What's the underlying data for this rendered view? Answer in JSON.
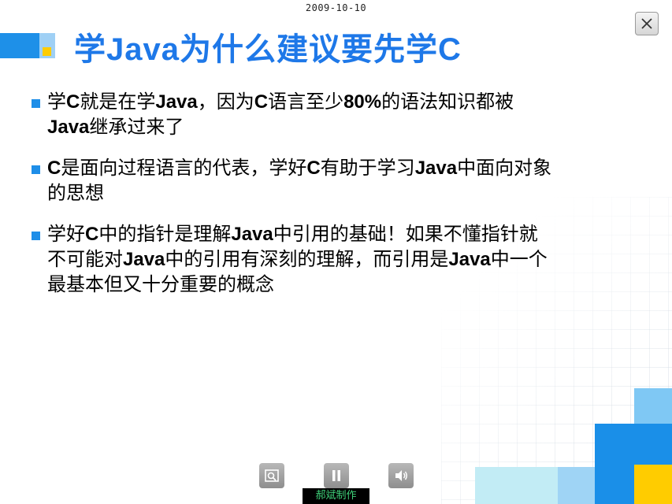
{
  "header": {
    "date": "2009-10-10"
  },
  "window": {
    "close_icon": "close-icon"
  },
  "slide": {
    "title": "学Java为什么建议要先学C",
    "bullets": [
      {
        "lines": [
          "学C就是在学Java，因为C语言至少80%的语法知识都被",
          "Java继承过来了"
        ]
      },
      {
        "lines": [
          "C是面向过程语言的代表，学好C有助于学习Java中面向对象",
          "的思想"
        ]
      },
      {
        "lines": [
          "学好C中的指针是理解Java中引用的基础！如果不懂指针就",
          "不可能对Java中的引用有深刻的理解，而引用是Java中一个",
          "最基本但又十分重要的概念"
        ]
      }
    ]
  },
  "controls": {
    "zoom_icon": "zoom-icon",
    "pause_icon": "pause-icon",
    "sound_icon": "speaker-icon"
  },
  "footer": {
    "credit": "郝斌制作"
  },
  "colors": {
    "title": "#1e78e8",
    "accent_blue": "#1a8fe8",
    "light_blue": "#9fd4f5",
    "yellow": "#ffcc00",
    "credit_text": "#3fd27a"
  }
}
